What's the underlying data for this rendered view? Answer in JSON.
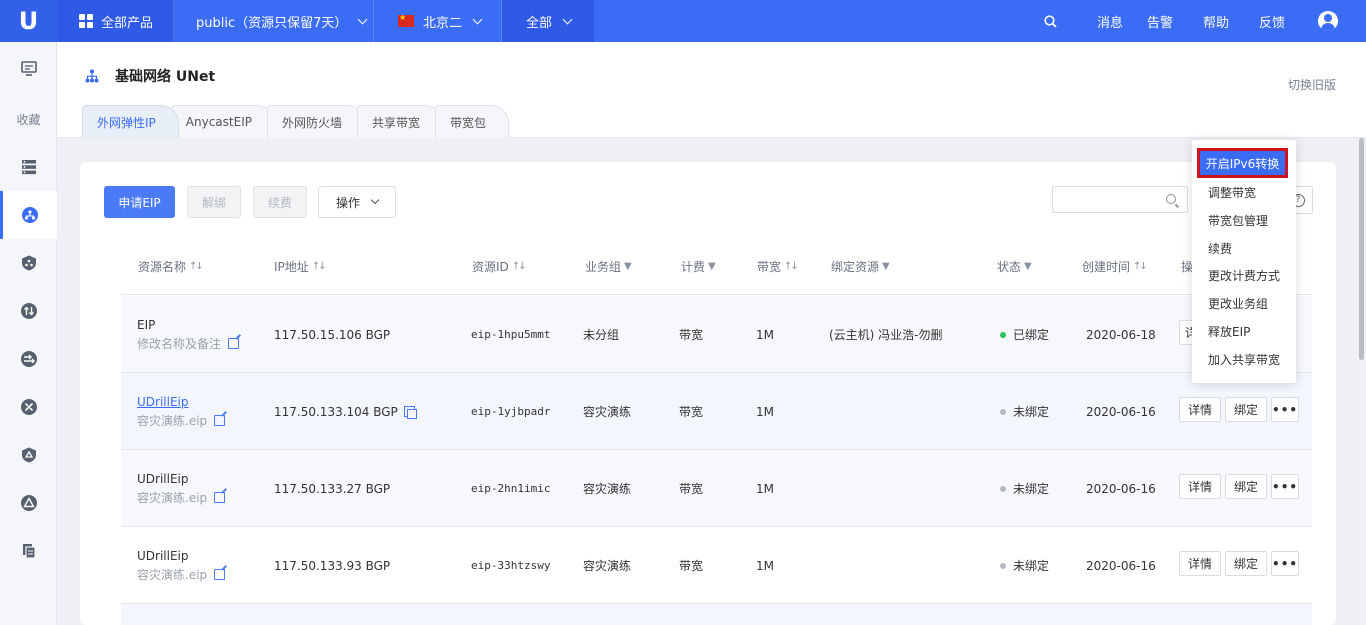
{
  "topbar": {
    "products": "全部产品",
    "project": "public（资源只保留7天）",
    "region": "北京二",
    "scope": "全部",
    "messages": "消息",
    "alerts": "告警",
    "help": "帮助",
    "feedback": "反馈"
  },
  "sidebar": {
    "favorites": "收藏"
  },
  "header": {
    "title": "基础网络 UNet",
    "switch_old": "切换旧版"
  },
  "tabs": [
    "外网弹性IP",
    "AnycastEIP",
    "外网防火墙",
    "共享带宽",
    "带宽包"
  ],
  "toolbar": {
    "apply": "申请EIP",
    "unbind": "解绑",
    "renew": "续费",
    "operate": "操作",
    "search_placeholder": "",
    "help_glyph": "?"
  },
  "table": {
    "headers": {
      "name": "资源名称",
      "ip": "IP地址",
      "id": "资源ID",
      "group": "业务组",
      "billing": "计费",
      "bandwidth": "带宽",
      "bound": "绑定资源",
      "status": "状态",
      "created": "创建时间",
      "ops": "操"
    },
    "rows": [
      {
        "name": "EIP",
        "sub": "修改名称及备注",
        "ip": "117.50.15.106 BGP",
        "id": "eip-1hpu5mmt",
        "group": "未分组",
        "billing": "带宽",
        "bw": "1M",
        "bound": "(云主机) 冯业浩-勿删",
        "status": "已绑定",
        "created": "2020-06-18",
        "detail": "详",
        "bind": "",
        "more": ""
      },
      {
        "name": "UDrillEip",
        "sub": "容灾演练.eip",
        "ip": "117.50.133.104 BGP",
        "id": "eip-1yjbpadr",
        "group": "容灾演练",
        "billing": "带宽",
        "bw": "1M",
        "bound": "",
        "status": "未绑定",
        "created": "2020-06-16",
        "detail": "详情",
        "bind": "绑定",
        "more": "•••"
      },
      {
        "name": "UDrillEip",
        "sub": "容灾演练.eip",
        "ip": "117.50.133.27 BGP",
        "id": "eip-2hn1imic",
        "group": "容灾演练",
        "billing": "带宽",
        "bw": "1M",
        "bound": "",
        "status": "未绑定",
        "created": "2020-06-16",
        "detail": "详情",
        "bind": "绑定",
        "more": "•••"
      },
      {
        "name": "UDrillEip",
        "sub": "容灾演练.eip",
        "ip": "117.50.133.93 BGP",
        "id": "eip-33htzswy",
        "group": "容灾演练",
        "billing": "带宽",
        "bw": "1M",
        "bound": "",
        "status": "未绑定",
        "created": "2020-06-16",
        "detail": "详情",
        "bind": "绑定",
        "more": "•••"
      }
    ]
  },
  "dropdown": {
    "items": [
      "开启IPv6转换",
      "调整带宽",
      "带宽包管理",
      "续费",
      "更改计费方式",
      "更改业务组",
      "释放EIP",
      "加入共享带宽"
    ]
  },
  "colors": {
    "brand": "#3b6cf5",
    "bound_status": "#2bc15a",
    "unbound_status": "#b5b9c1",
    "highlight_border": "#d0121b"
  }
}
